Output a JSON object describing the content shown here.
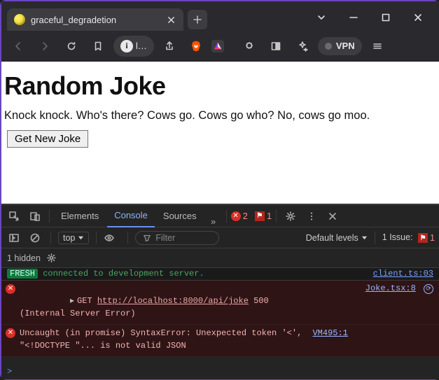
{
  "window": {
    "tab_title": "graceful_degradetion"
  },
  "url_fragment": "l…",
  "vpn_label": "VPN",
  "page": {
    "heading": "Random Joke",
    "joke_text": "Knock knock. Who's there? Cows go. Cows go who? No, cows go moo.",
    "button_label": "Get New Joke"
  },
  "devtools": {
    "tabs": {
      "elements": "Elements",
      "console": "Console",
      "sources": "Sources"
    },
    "error_count": "2",
    "issue_badge_count": "1",
    "context_label": "top",
    "filter_placeholder": "Filter",
    "levels_label": "Default levels",
    "issues_label": "1 Issue:",
    "issues_count": "1",
    "hidden_label": "1 hidden",
    "cutoff_word": "FRESH",
    "cutoff_text": "  connected to development server.",
    "cutoff_right": "client.ts:03",
    "errors": [
      {
        "line1_prefix": "GET ",
        "url": "http://localhost:8000/api/joke",
        "status": " 500",
        "line2": "(Internal Server Error)",
        "source": "Joke.tsx:8",
        "expandable": true,
        "has_ext": true
      },
      {
        "text": "Uncaught (in promise) SyntaxError: Unexpected token '<', ",
        "line2": "\"<!DOCTYPE \"... is not valid JSON",
        "source": "VM495:1",
        "expandable": false,
        "has_ext": false
      }
    ],
    "prompt": ">"
  }
}
